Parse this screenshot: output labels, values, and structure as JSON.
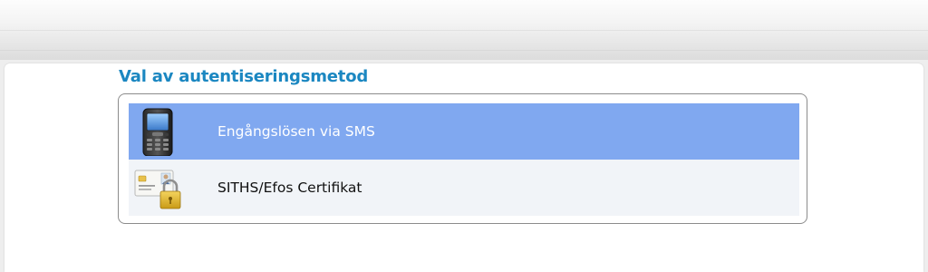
{
  "heading": "Val av autentiseringsmetod",
  "methods": [
    {
      "label": "Engångslösen via SMS",
      "icon": "mobile-phone-icon",
      "selected": true
    },
    {
      "label": "SITHS/Efos Certifikat",
      "icon": "certificate-card-lock-icon",
      "selected": false
    }
  ],
  "colors": {
    "heading": "#1b87c1",
    "selected_row": "#80a8f0",
    "row": "#f1f4f8"
  }
}
